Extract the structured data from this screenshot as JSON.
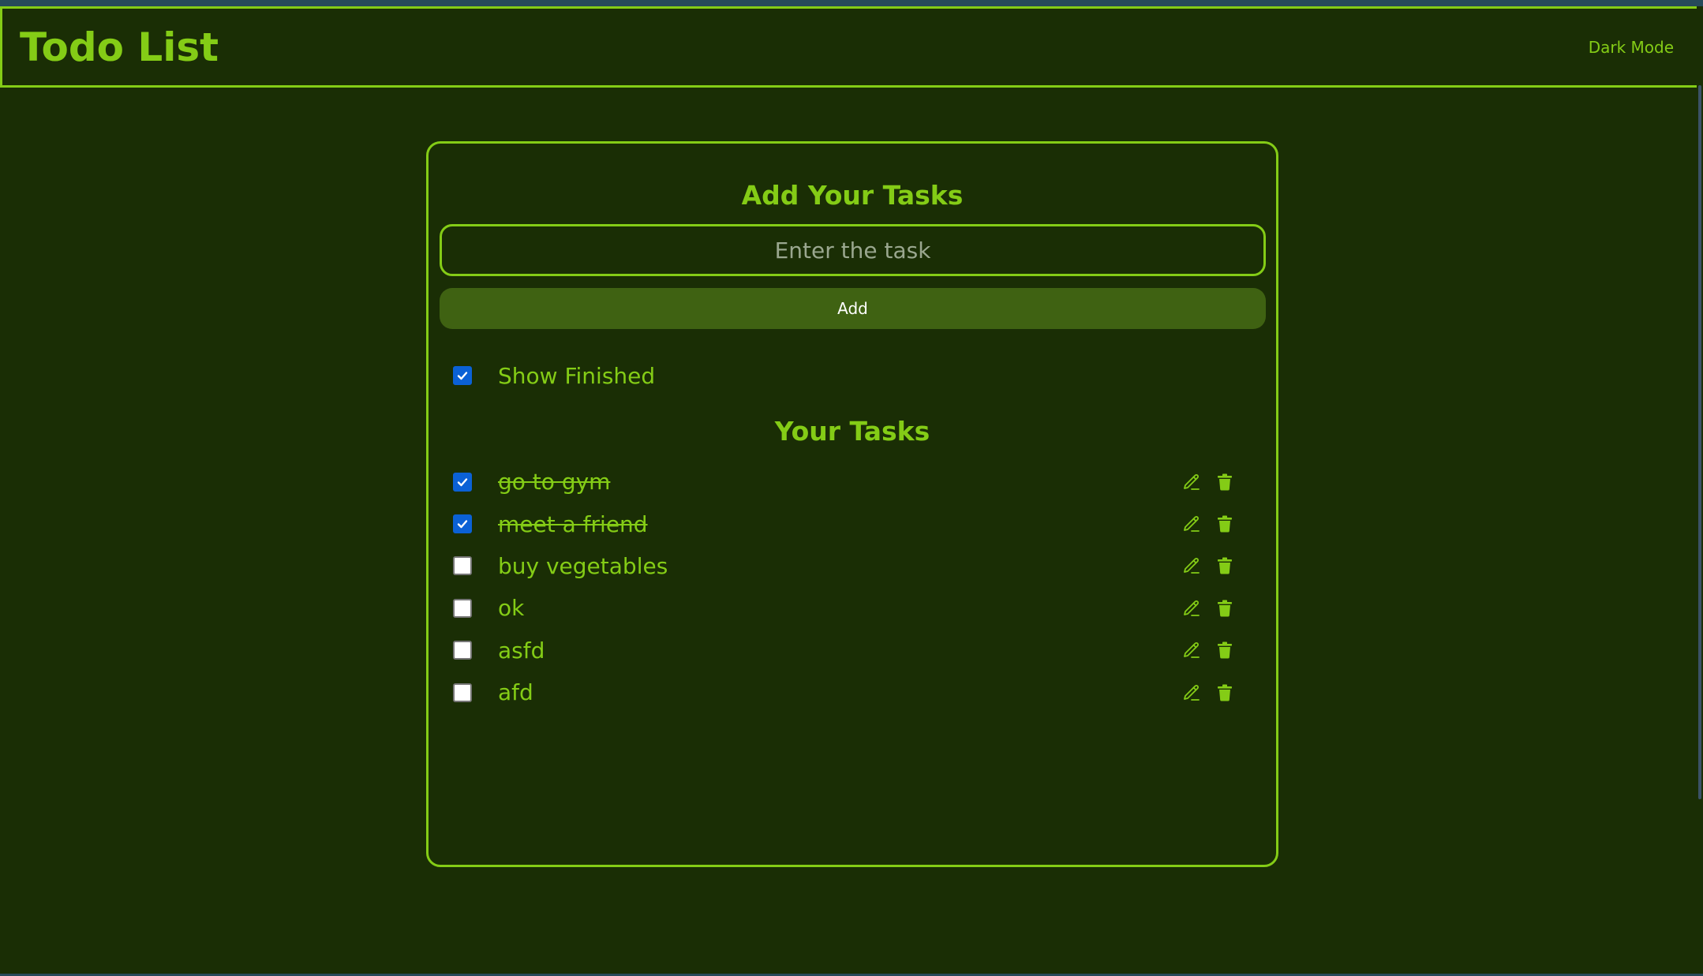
{
  "navbar": {
    "brand": "Todo List",
    "mode_toggle": "Dark Mode"
  },
  "add_section": {
    "title": "Add Your Tasks",
    "input_placeholder": "Enter the task",
    "input_value": "",
    "add_button": "Add"
  },
  "show_finished": {
    "label": "Show Finished",
    "checked": true
  },
  "tasks_section": {
    "title": "Your Tasks",
    "tasks": [
      {
        "text": "go to gym",
        "done": true
      },
      {
        "text": "meet a friend",
        "done": true
      },
      {
        "text": "buy vegetables",
        "done": false
      },
      {
        "text": "ok",
        "done": false
      },
      {
        "text": "asfd",
        "done": false
      },
      {
        "text": "afd",
        "done": false
      }
    ],
    "edit_icon": "pencil-icon",
    "delete_icon": "trash-icon"
  },
  "colors": {
    "background": "#1a2e05",
    "accent": "#84cc16",
    "button": "#3f6212",
    "checkbox_checked": "#0b61d6"
  }
}
